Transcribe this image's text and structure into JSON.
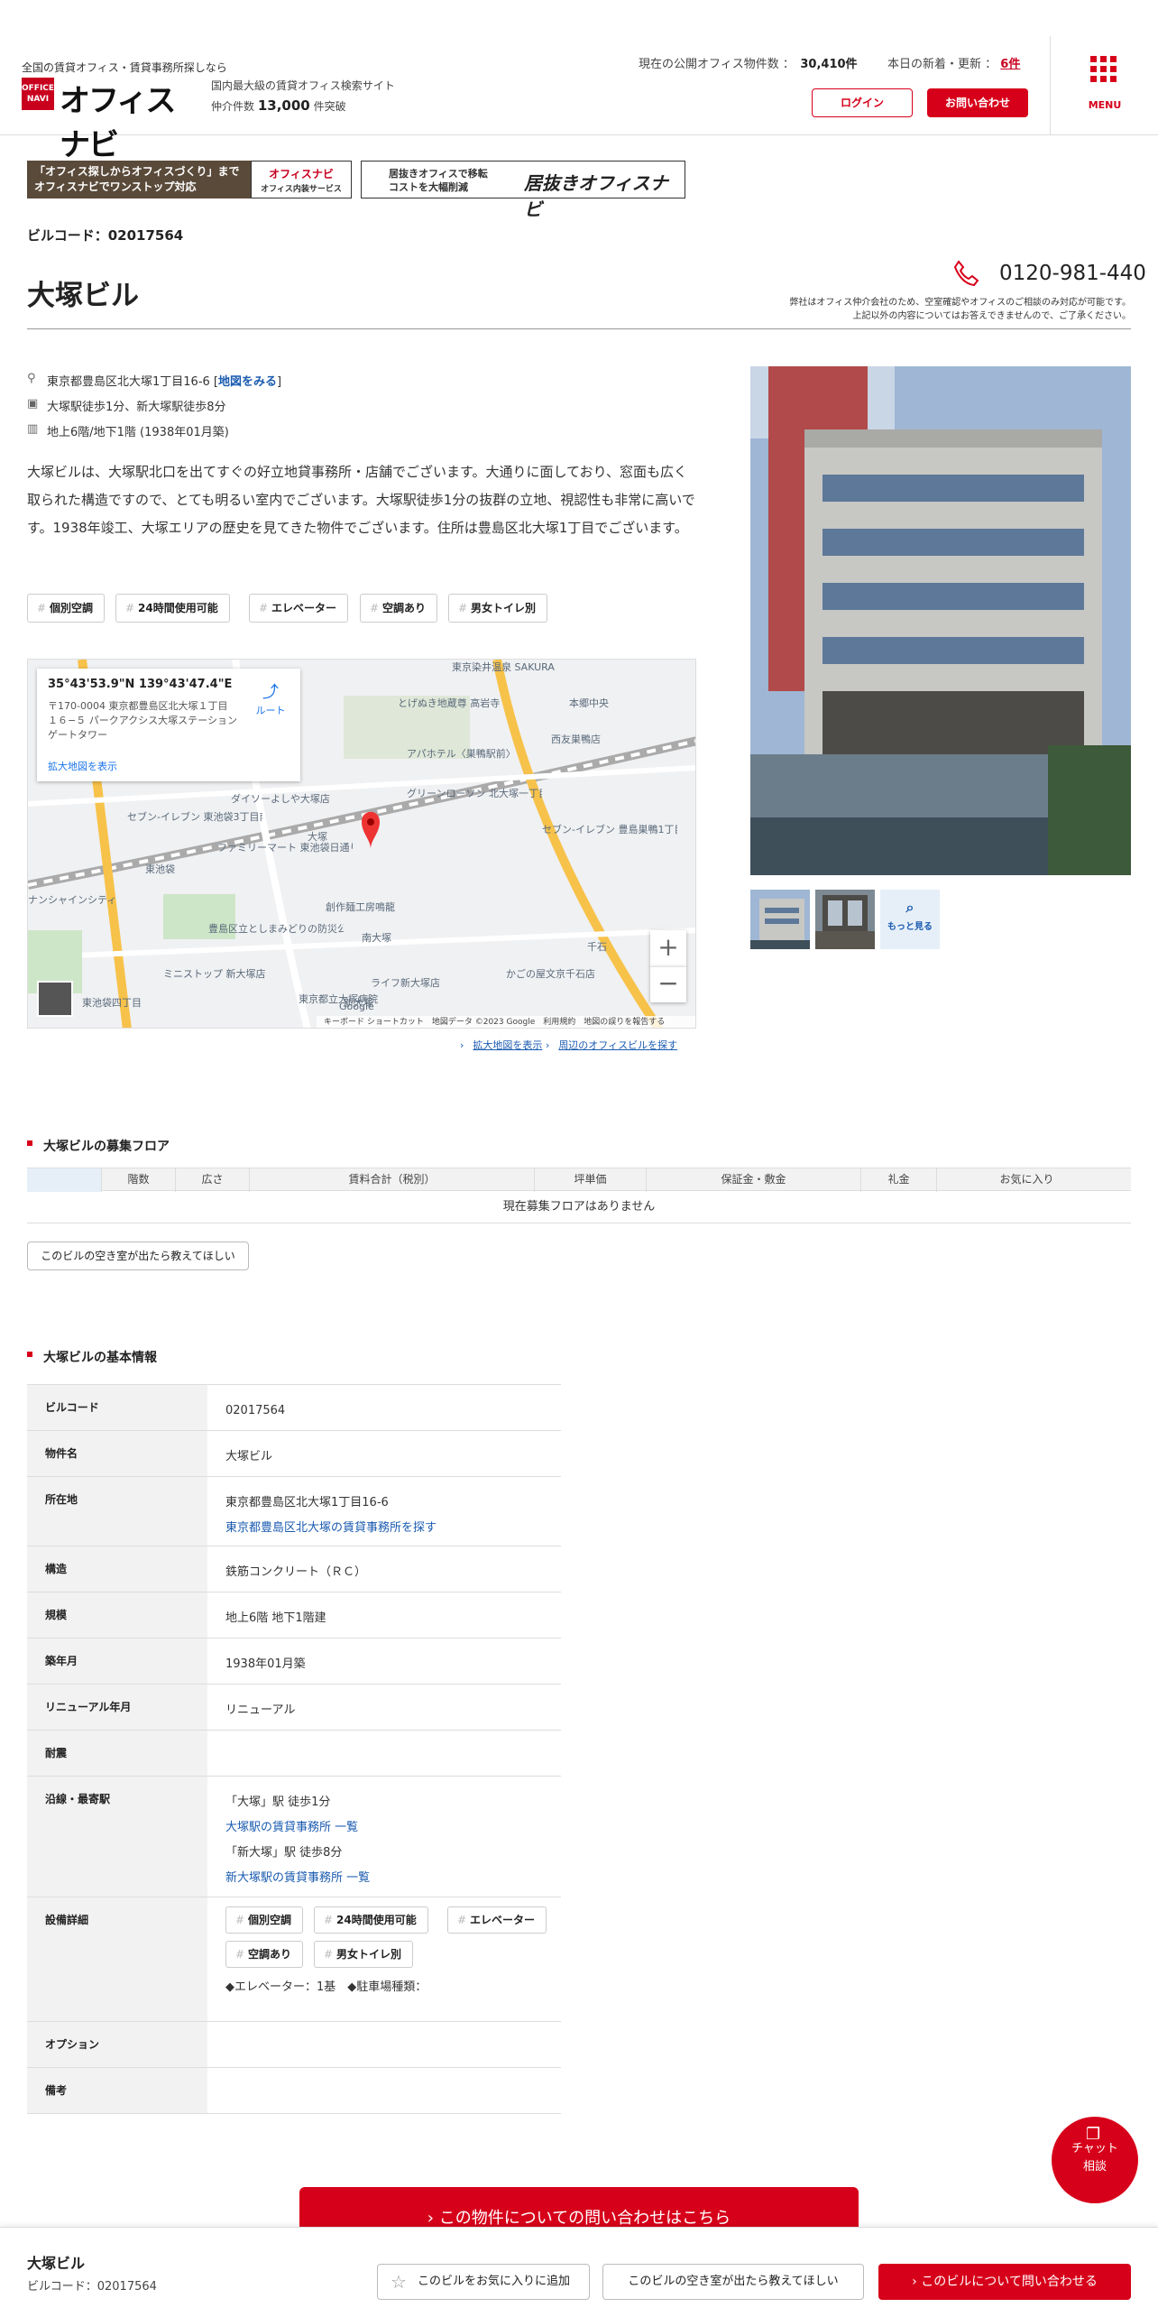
{
  "header": {
    "tagline": "全国の賃貸オフィス・賃貸事務所探しなら",
    "logo_text": "オフィスナビ",
    "logo_badge": "OFFICE NAVI",
    "site_desc": "国内最大級の賃貸オフィス検索サイト",
    "count_prefix": "仲介件数",
    "count_value": "13,000",
    "count_suffix": "件突破",
    "public_label": "現在の公開オフィス物件数 ：",
    "public_value": "30,410件",
    "new_label": "本日の新着・更新 ：",
    "new_value": "6件",
    "login": "ログイン",
    "contact": "お問い合わせ",
    "menu": "MENU"
  },
  "banners": {
    "b1_line1": "「オフィス探しからオフィスづくり」まで",
    "b1_line2": "オフィスナビでワンストップ対応",
    "b1_logo": "オフィスナビ",
    "b1_sub": "オフィス内装サービス",
    "b2_line1": "居抜きオフィスで移転",
    "b2_line2": "コストを大幅削減",
    "b2_logo": "居抜きオフィスナビ"
  },
  "building": {
    "code_label": "ビルコード：02017564",
    "name": "大塚ビル",
    "phone": "0120-981-440",
    "phone_note1": "弊社はオフィス仲介会社のため、空室確認やオフィスのご相談のみ対応が可能です。",
    "phone_note2": "上記以外の内容についてはお答えできませんので、ご了承ください。",
    "address": "東京都豊島区北大塚1丁目16-6 [",
    "map_link": "地図をみる",
    "address_end": "]",
    "access": "大塚駅徒歩1分、新大塚駅徒歩8分",
    "floors": "地上6階/地下1階 (1938年01月築)",
    "description": "大塚ビルは、大塚駅北口を出てすぐの好立地貸事務所・店舗でございます。大通りに面しており、窓面も広く取られた構造ですので、とても明るい室内でございます。大塚駅徒歩1分の抜群の立地、視認性も非常に高いです。1938年竣工、大塚エリアの歴史を見てきた物件でございます。住所は豊島区北大塚1丁目でございます。",
    "tags": [
      "個別空調",
      "24時間使用可能",
      "エレベーター",
      "空調あり",
      "男女トイレ別"
    ]
  },
  "map": {
    "coords": "35°43'53.9\"N 139°43'47.4\"E",
    "addr": "〒170-0004 東京都豊島区北大塚１丁目１６−５ パークアクシス大塚ステーションゲートタワー",
    "enlarge": "拡大地図を表示",
    "route": "ルート",
    "footer": "キーボード ショートカット　地図データ ©2023 Google　利用規約　地図の誤りを報告する",
    "labels": [
      "東京染井温泉 SAKURA",
      "とげぬき地蔵尊 高岩寺",
      "本郷中央",
      "西友巣鴨店",
      "アパホテル〈巣鴨駅前〉",
      "ダイソーよしや大塚店",
      "グリーンローソン 北大塚一丁目店",
      "セブン-イレブン 豊島巣鴨1丁目店",
      "セブン-イレブン 東池袋3丁目南店",
      "ファミリーマート 東池袋日通り店",
      "創作麺工房鳴龍",
      "豊島区立としまみどりの防災公園",
      "南大塚",
      "ミニストップ 新大塚店",
      "ライフ新大塚店",
      "かごの屋文京千石店",
      "東京都立大塚病院",
      "千石",
      "東池袋",
      "大塚",
      "新大塚",
      "東池袋四丁目",
      "ナンシャインシティ",
      "Google"
    ],
    "link1": "拡大地図を表示",
    "link2": "周辺のオフィスビルを探す"
  },
  "gallery": {
    "more": "もっと見る"
  },
  "vacancy": {
    "section_title": "大塚ビルの募集フロア",
    "columns": [
      "",
      "階数",
      "広さ",
      "賃料合計（税別）",
      "坪単価",
      "保証金・敷金",
      "礼金",
      "お気に入り"
    ],
    "empty": "現在募集フロアはありません",
    "notify": "このビルの空き室が出たら教えてほしい"
  },
  "basic": {
    "section_title": "大塚ビルの基本情報",
    "rows": [
      {
        "k": "ビルコード",
        "v": "02017564"
      },
      {
        "k": "物件名",
        "v": "大塚ビル"
      },
      {
        "k": "所在地",
        "v": "東京都豊島区北大塚1丁目16-6",
        "link": "東京都豊島区北大塚の賃貸事務所を探す"
      },
      {
        "k": "構造",
        "v": "鉄筋コンクリート（ＲＣ）"
      },
      {
        "k": "規模",
        "v": "地上6階 地下1階建"
      },
      {
        "k": "築年月",
        "v": "1938年01月築"
      },
      {
        "k": "リニューアル年月",
        "v": "リニューアル"
      },
      {
        "k": "耐震",
        "v": ""
      },
      {
        "k": "沿線・最寄駅",
        "v": "「大塚」駅 徒歩1分",
        "link": "大塚駅の賃貸事務所 一覧",
        "v2": "「新大塚」駅 徒歩8分",
        "link2": "新大塚駅の賃貸事務所 一覧"
      },
      {
        "k": "設備詳細",
        "v": "◆エレベーター：1基　◆駐車場種類："
      },
      {
        "k": "オプション",
        "v": ""
      },
      {
        "k": "備考",
        "v": ""
      }
    ]
  },
  "chat": {
    "l1": "チャット",
    "l2": "相談"
  },
  "cta": "この物件についての問い合わせはこちら",
  "footer": {
    "name": "大塚ビル",
    "code": "ビルコード：02017564",
    "fav": "このビルをお気に入りに追加",
    "notify": "このビルの空き室が出たら教えてほしい",
    "inquire": "このビルについて問い合わせる"
  }
}
